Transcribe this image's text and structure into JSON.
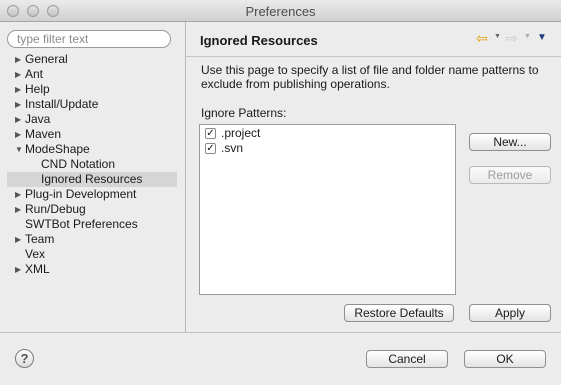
{
  "window": {
    "title": "Preferences"
  },
  "sidebar": {
    "filter_placeholder": "type filter text",
    "items": [
      {
        "label": "General",
        "expandable": true
      },
      {
        "label": "Ant",
        "expandable": true
      },
      {
        "label": "Help",
        "expandable": true
      },
      {
        "label": "Install/Update",
        "expandable": true
      },
      {
        "label": "Java",
        "expandable": true
      },
      {
        "label": "Maven",
        "expandable": true
      },
      {
        "label": "ModeShape",
        "expandable": true,
        "expanded": true
      },
      {
        "label": "CND Notation",
        "child": true
      },
      {
        "label": "Ignored Resources",
        "child": true,
        "selected": true
      },
      {
        "label": "Plug-in Development",
        "expandable": true
      },
      {
        "label": "Run/Debug",
        "expandable": true
      },
      {
        "label": "SWTBot Preferences"
      },
      {
        "label": "Team",
        "expandable": true
      },
      {
        "label": "Vex"
      },
      {
        "label": "XML",
        "expandable": true
      }
    ]
  },
  "page": {
    "title": "Ignored Resources",
    "description": "Use this page to specify a list of file and folder name patterns to exclude from publishing operations.",
    "patterns_label": "Ignore Patterns:",
    "patterns": [
      {
        "text": ".project",
        "checked": true
      },
      {
        "text": ".svn",
        "checked": true
      }
    ],
    "new_label": "New...",
    "remove_label": "Remove",
    "restore_defaults_label": "Restore Defaults",
    "apply_label": "Apply"
  },
  "footer": {
    "help_symbol": "?",
    "cancel_label": "Cancel",
    "ok_label": "OK"
  },
  "icons": {
    "expand_collapsed": "▶",
    "expand_open": "▼",
    "back": "⇦",
    "forward": "⇨",
    "dropdown": "▼",
    "view_menu": "▼",
    "check": "✓"
  },
  "colors": {
    "back_arrow": "#e0a400",
    "selection": "#d5d5d5",
    "view_menu": "#1f3d7a"
  }
}
